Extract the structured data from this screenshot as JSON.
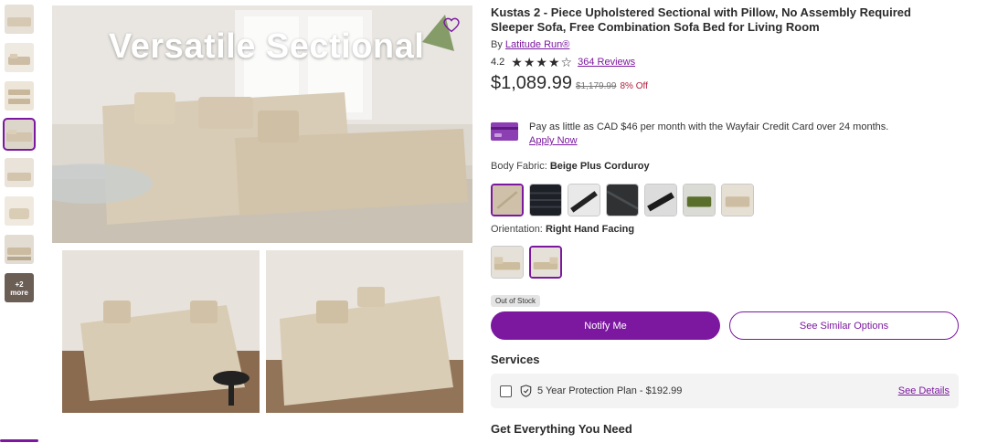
{
  "gallery": {
    "overlay_title": "Versatile Sectional",
    "more_label_line1": "+2",
    "more_label_line2": "more",
    "thumbnail_count": 8,
    "active_thumbnail_index": 3
  },
  "product": {
    "title": "Kustas 2 - Piece Upholstered Sectional with Pillow, No Assembly Required Sleeper Sofa, Free Combination Sofa Bed for Living Room",
    "by_prefix": "By",
    "brand": "Latitude Run®",
    "rating": "4.2",
    "stars_filled": 4,
    "stars_total": 5,
    "reviews": "364 Reviews",
    "price": "$1,089.99",
    "old_price": "$1,179.99",
    "discount": "8% Off"
  },
  "credit": {
    "text": "Pay as little as CAD $46 per month with the Wayfair Credit Card over 24 months.",
    "link": "Apply Now"
  },
  "options": {
    "fabric_label": "Body Fabric:",
    "fabric_value": "Beige Plus Corduroy",
    "fabric_swatches": [
      "beige corduroy",
      "black corduroy",
      "white/black",
      "charcoal",
      "black/white",
      "green",
      "beige"
    ],
    "orientation_label": "Orientation:",
    "orientation_value": "Right Hand Facing",
    "orientation_swatches": [
      "left hand facing",
      "right hand facing"
    ]
  },
  "stock": {
    "badge": "Out of Stock"
  },
  "actions": {
    "notify": "Notify Me",
    "similar": "See Similar Options"
  },
  "services": {
    "heading": "Services",
    "plan": "5 Year Protection Plan - $192.99",
    "details": "See Details"
  },
  "section": {
    "get_everything": "Get Everything You Need"
  },
  "colors": {
    "accent": "#7b189f",
    "discount": "#b2213c"
  }
}
